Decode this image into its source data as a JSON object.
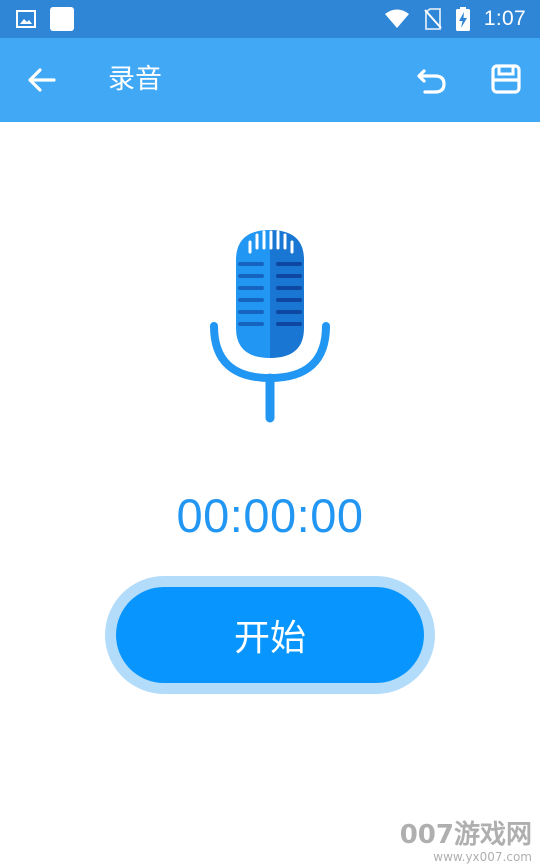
{
  "status_bar": {
    "time": "1:07",
    "icons": [
      "image-icon",
      "app-square-icon",
      "wifi-icon",
      "no-sim-icon",
      "battery-charging-icon"
    ]
  },
  "app_bar": {
    "title": "录音",
    "back_icon": "arrow-left-icon",
    "undo_icon": "undo-icon",
    "save_icon": "save-icon"
  },
  "recorder": {
    "icon": "microphone-icon",
    "timer": "00:00:00",
    "start_label": "开始"
  },
  "watermark": {
    "logo": "007游戏网",
    "url": "www.yx007.com"
  },
  "colors": {
    "status_bar": "#2f86d6",
    "app_bar": "#41a8f5",
    "accent": "#2196f3",
    "button": "#0896fe",
    "button_halo": "#b3dcfb"
  }
}
